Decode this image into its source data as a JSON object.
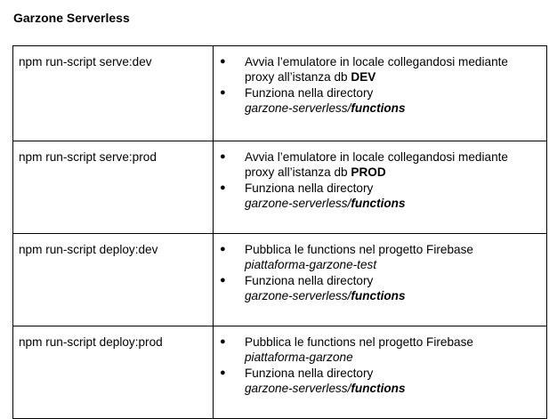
{
  "document": {
    "title": "Garzone Serverless"
  },
  "bullet_glyph": "●",
  "rows": [
    {
      "command": "npm run-script serve:dev",
      "bullets": [
        {
          "text_prefix": "Avvia l’emulatore in locale collegandosi mediante proxy all’istanza db ",
          "text_bold": "DEV"
        },
        {
          "text": "Funziona nella directory",
          "path_italic": "garzone-serverless/",
          "path_bold_italic": "functions"
        }
      ]
    },
    {
      "command": "npm run-script serve:prod",
      "bullets": [
        {
          "text_prefix": "Avvia l’emulatore in locale collegandosi mediante proxy all’istanza db ",
          "text_bold": "PROD"
        },
        {
          "text": "Funziona nella directory",
          "path_italic": "garzone-serverless/",
          "path_bold_italic": "functions"
        }
      ]
    },
    {
      "command": "npm run-script deploy:dev",
      "bullets": [
        {
          "text": "Pubblica le functions nel progetto Firebase",
          "project_italic": "piattaforma-garzone-test"
        },
        {
          "text": "Funziona nella directory",
          "path_italic": "garzone-serverless/",
          "path_bold_italic": "functions"
        }
      ]
    },
    {
      "command": "npm run-script deploy:prod",
      "bullets": [
        {
          "text": "Pubblica le functions nel progetto Firebase",
          "project_italic": "piattaforma-garzone"
        },
        {
          "text": "Funziona nella directory",
          "path_italic": "garzone-serverless/",
          "path_bold_italic": "functions"
        }
      ]
    }
  ]
}
